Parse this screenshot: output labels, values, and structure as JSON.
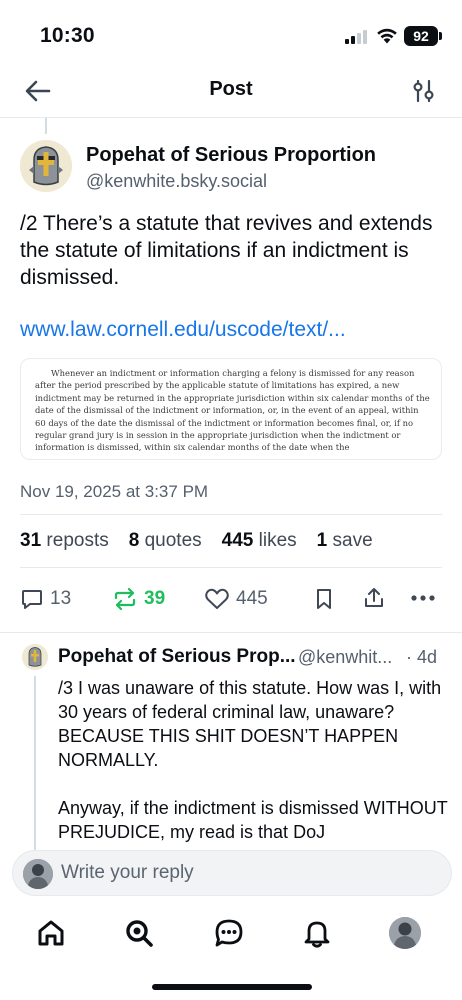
{
  "status_bar": {
    "time": "10:30",
    "battery": "92"
  },
  "header": {
    "title": "Post"
  },
  "post": {
    "author_name": "Popehat of Serious Proportion",
    "author_handle": "@kenwhite.bsky.social",
    "text": "/2 There’s a statute that revives and extends the statute of limitations if an indictment is dismissed.",
    "link": "www.law.cornell.edu/uscode/text/...",
    "quote_image_text": "Whenever an indictment or information charging a felony is dismissed for any reason after the period prescribed by the applicable statute of limitations has expired, a new indictment may be returned in the appropriate jurisdiction within six calendar months of the date of the dismissal of the indictment or information, or, in the event of an appeal, within 60 days of the date the dismissal of the indictment or information becomes final, or, if no regular grand jury is in session in the appropriate jurisdiction when the indictment or information is dismissed, within six calendar months of the date when the",
    "timestamp": "Nov 19, 2025 at 3:37 PM",
    "stats": {
      "reposts_count": "31",
      "reposts_label": "reposts",
      "quotes_count": "8",
      "quotes_label": "quotes",
      "likes_count": "445",
      "likes_label": "likes",
      "saves_count": "1",
      "saves_label": "save"
    },
    "actions": {
      "replies": "13",
      "reposts": "39",
      "likes": "445"
    }
  },
  "reply": {
    "author_name": "Popehat of Serious Prop...",
    "author_handle": "@kenwhit...",
    "age": "· 4d",
    "text": "/3 I was unaware of this statute. How was I, with 30 years of federal criminal law, unaware?  BECAUSE THIS SHIT DOESN’T HAPPEN NORMALLY.\n\nAnyway, if the indictment is dismissed WITHOUT PREJUDICE, my read is that DoJ"
  },
  "composer": {
    "placeholder": "Write your reply"
  },
  "colors": {
    "accent": "#1877e8",
    "repost_active": "#20bc5e",
    "text": "#0b0f14",
    "muted": "#55606e"
  },
  "icons": [
    "back-arrow-icon",
    "filter-sliders-icon",
    "reply-bubble-icon",
    "repost-icon",
    "heart-icon",
    "bookmark-icon",
    "share-icon",
    "more-dots-icon",
    "home-icon",
    "search-icon",
    "chat-icon",
    "bell-icon"
  ]
}
